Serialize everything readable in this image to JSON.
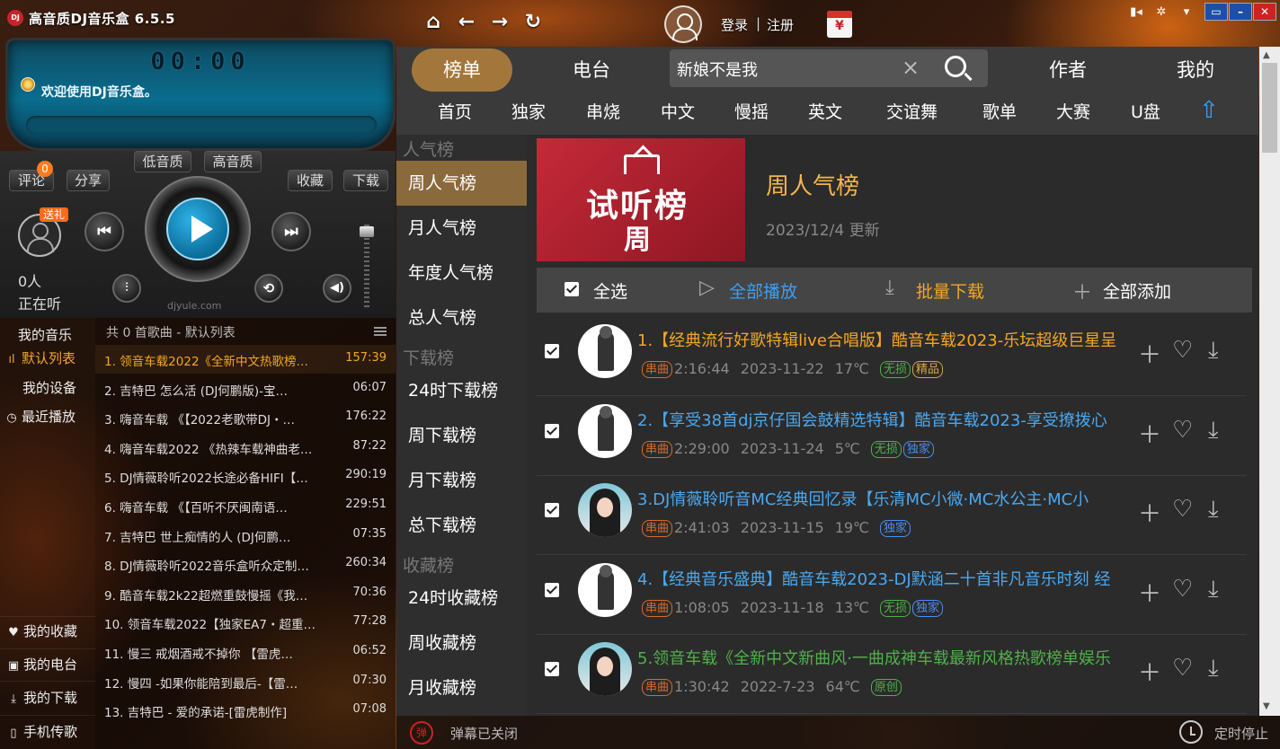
{
  "app": {
    "title": "高音质DJ音乐盒 6.5.5",
    "logo": "DJ",
    "login": "登录",
    "register": "注册",
    "separator": "|",
    "gift_char": "¥"
  },
  "player": {
    "time": "00:00",
    "welcome": "欢迎使用DJ音乐盒。",
    "low_quality": "低音质",
    "high_quality": "高音质",
    "comment": "评论",
    "comment_count": "0",
    "share": "分享",
    "favorite": "收藏",
    "download": "下载",
    "gift": "送礼",
    "listeners": "0人",
    "listening": "正在听",
    "site": "djyule.com"
  },
  "left_nav": {
    "my_music": "我的音乐",
    "default_list": "默认列表",
    "my_device": "我的设备",
    "recent": "最近播放",
    "my_favorites": "我的收藏",
    "my_radio": "我的电台",
    "my_downloads": "我的下载",
    "phone_transfer": "手机传歌"
  },
  "playlist": {
    "header": "共 0 首歌曲 - 默认列表",
    "items": [
      {
        "title": "1.  领音车载2022《全新中文热歌榜…",
        "duration": "157:39"
      },
      {
        "title": "2.  吉特巴   怎么活 (DJ何鹏版)-宝…",
        "duration": "06:07"
      },
      {
        "title": "3.  嗨音车载 《【2022老歌带DJ・…",
        "duration": "176:22"
      },
      {
        "title": "4.  嗨音车载2022 《热辣车载神曲老…",
        "duration": "87:22"
      },
      {
        "title": "5.  DJ情薇聆听2022长途必备HIFI【…",
        "duration": "290:19"
      },
      {
        "title": "6.  嗨音车载 《【百听不厌闽南语…",
        "duration": "229:51"
      },
      {
        "title": "7.  吉特巴   世上痴情的人 (DJ何鹏…",
        "duration": "07:35"
      },
      {
        "title": "8.  DJ情薇聆听2022音乐盒听众定制…",
        "duration": "260:34"
      },
      {
        "title": "9.  酷音车载2k22超燃重鼓慢摇《我…",
        "duration": "70:36"
      },
      {
        "title": "10.  领音车载2022【独家EA7・超重…",
        "duration": "77:28"
      },
      {
        "title": "11.  慢三   戒烟酒戒不掉你 【雷虎…",
        "duration": "06:52"
      },
      {
        "title": "12.  慢四  -如果你能陪到最后-【雷…",
        "duration": "07:30"
      },
      {
        "title": "13.  吉特巴  - 爱的承诺-[雷虎制作]",
        "duration": "07:08"
      }
    ]
  },
  "top_tabs": {
    "charts": "榜单",
    "radio": "电台",
    "author": "作者",
    "mine": "我的"
  },
  "search": {
    "value": "新娘不是我",
    "clear": "×"
  },
  "sub_nav": [
    "首页",
    "独家",
    "串烧",
    "中文",
    "慢摇",
    "英文",
    "交谊舞",
    "歌单",
    "大赛",
    "U盘"
  ],
  "categories": {
    "popular": "人气榜",
    "week_popular": "周人气榜",
    "month_popular": "月人气榜",
    "year_popular": "年度人气榜",
    "total_popular": "总人气榜",
    "downloads": "下载榜",
    "dl_24h": "24时下载榜",
    "dl_week": "周下载榜",
    "dl_month": "月下载榜",
    "dl_total": "总下载榜",
    "favorites": "收藏榜",
    "fav_24h": "24时收藏榜",
    "fav_week": "周收藏榜",
    "fav_month": "月收藏榜"
  },
  "chart_header": {
    "cover_line1": "试听榜",
    "cover_line2": "周",
    "title": "周人气榜",
    "update": "2023/12/4 更新"
  },
  "actions": {
    "select_all": "全选",
    "play_all": "全部播放",
    "batch_download": "批量下载",
    "add_all": "全部添加"
  },
  "songs": [
    {
      "title": "1.【经典流行好歌特辑live合唱版】酷音车载2023-乐坛超级巨星呈",
      "color": "#f5a623",
      "duration": "2:16:44",
      "date": "2023-11-22",
      "temp": "17℃",
      "tags": [
        {
          "text": "串曲",
          "style": "red"
        },
        {
          "text": "无损",
          "style": "green"
        },
        {
          "text": "精品",
          "style": "gold"
        }
      ]
    },
    {
      "title": "2.【享受38首dj京仔国会鼓精选特辑】酷音车载2023-享受撩拨心",
      "color": "#4aa8f0",
      "duration": "2:29:00",
      "date": "2023-11-24",
      "temp": "5℃",
      "tags": [
        {
          "text": "串曲",
          "style": "red"
        },
        {
          "text": "无损",
          "style": "green"
        },
        {
          "text": "独家",
          "style": "blue"
        }
      ]
    },
    {
      "title": "3.DJ情薇聆听音MC经典回忆录【乐清MC小微·MC水公主·MC小",
      "color": "#4aa8f0",
      "duration": "2:41:03",
      "date": "2023-11-15",
      "temp": "19℃",
      "tags": [
        {
          "text": "串曲",
          "style": "red"
        },
        {
          "text": "独家",
          "style": "blue"
        }
      ]
    },
    {
      "title": "4.【经典音乐盛典】酷音车载2023-DJ默涵二十首非凡音乐时刻 经",
      "color": "#4aa8f0",
      "duration": "1:08:05",
      "date": "2023-11-18",
      "temp": "13℃",
      "tags": [
        {
          "text": "串曲",
          "style": "red"
        },
        {
          "text": "无损",
          "style": "green"
        },
        {
          "text": "独家",
          "style": "blue"
        }
      ]
    },
    {
      "title": "5.领音车载《全新中文新曲风·一曲成神车载最新风格热歌榜单娱乐",
      "color": "#4fb04a",
      "duration": "1:30:42",
      "date": "2022-7-23",
      "temp": "64℃",
      "tags": [
        {
          "text": "串曲",
          "style": "red"
        },
        {
          "text": "原创",
          "style": "green"
        }
      ]
    }
  ],
  "status": {
    "danmu": "弹幕已关闭",
    "timer": "定时停止"
  }
}
